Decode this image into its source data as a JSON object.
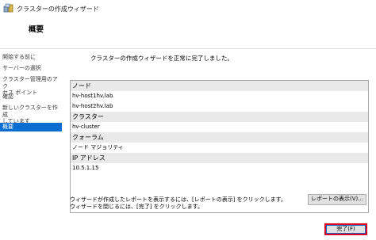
{
  "window": {
    "title": "クラスターの作成ウィザード"
  },
  "header": {
    "page_title": "概要"
  },
  "sidebar": {
    "items": [
      {
        "label": "開始する前に",
        "selected": false
      },
      {
        "label": "サーバーの選択",
        "selected": false
      },
      {
        "label": "クラスター管理用のアク\nセス ポイント",
        "selected": false
      },
      {
        "label": "確認",
        "selected": false
      },
      {
        "label": "新しいクラスターを作成\nしています",
        "selected": false
      },
      {
        "label": "概要",
        "selected": true
      }
    ]
  },
  "main": {
    "status_text": "クラスターの作成ウィザードを正常に完了しました。",
    "report_rows": [
      {
        "text": "ノード",
        "section": true
      },
      {
        "text": "hv-host1hv.lab",
        "section": false
      },
      {
        "text": "hv-host2hv.lab",
        "section": false
      },
      {
        "text": "クラスター",
        "section": true
      },
      {
        "text": "hv-cluster",
        "section": false
      },
      {
        "text": "クォーラム",
        "section": true
      },
      {
        "text": "ノード マジョリティ",
        "section": false
      },
      {
        "text": "IP アドレス",
        "section": true
      },
      {
        "text": "10.5.1.15",
        "section": false
      }
    ],
    "note_line1": "ウィザードが作成したレポートを表示するには、[レポートの表示] をクリックします。",
    "note_line2": "ウィザードを閉じるには、[完了] をクリックします。",
    "view_report_label": "レポートの表示(V)..."
  },
  "footer": {
    "finish_label": "完了(F)"
  },
  "colors": {
    "accent": "#0a6dcf",
    "highlight": "#e0001a"
  }
}
